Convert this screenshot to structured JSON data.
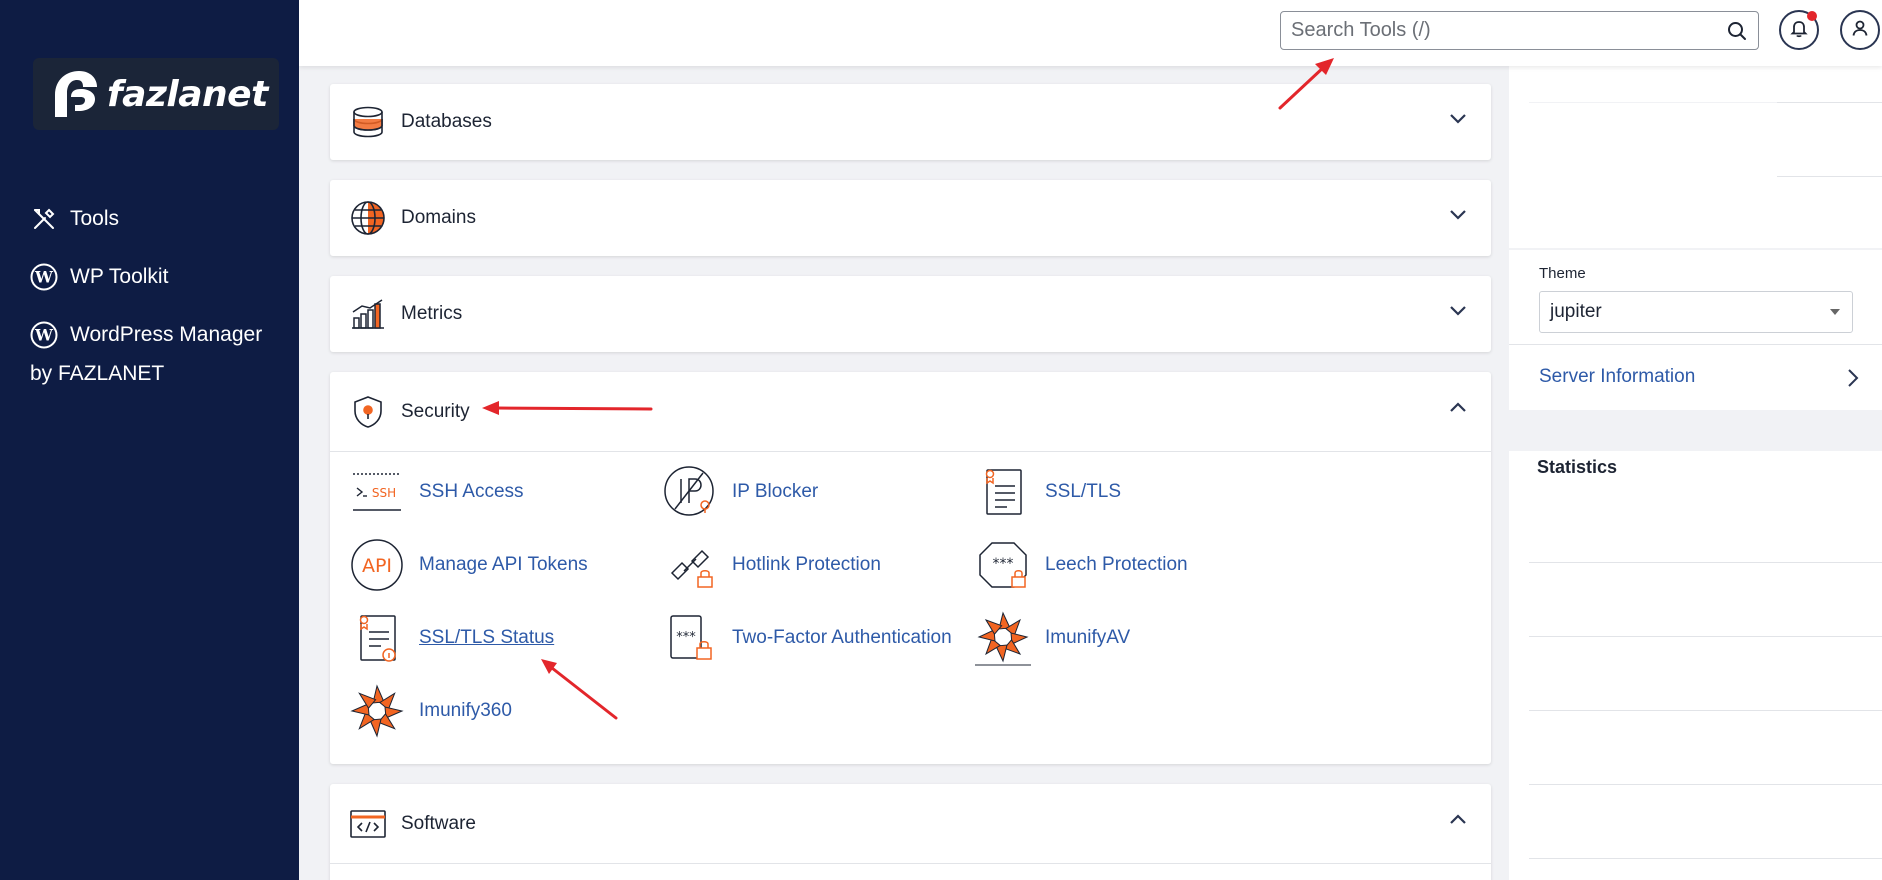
{
  "sidebar": {
    "logo_text": "fazlanet",
    "items": [
      {
        "label": "Tools",
        "icon": "tools-icon"
      },
      {
        "label": "WP Toolkit",
        "icon": "wordpress-icon"
      },
      {
        "label": "WordPress Manager",
        "icon": "wordpress-icon"
      }
    ],
    "item3_sub": "by FAZLANET"
  },
  "topbar": {
    "search_placeholder": "Search Tools (/)",
    "notification_badge_color": "#e3262b"
  },
  "panels": {
    "databases": {
      "title": "Databases"
    },
    "domains": {
      "title": "Domains"
    },
    "metrics": {
      "title": "Metrics"
    },
    "security": {
      "title": "Security",
      "tools": [
        {
          "label": "SSH Access",
          "icon": "ssh-icon"
        },
        {
          "label": "IP Blocker",
          "icon": "ip-blocker-icon"
        },
        {
          "label": "SSL/TLS",
          "icon": "ssl-certificate-icon"
        },
        {
          "label": "Manage API Tokens",
          "icon": "api-icon"
        },
        {
          "label": "Hotlink Protection",
          "icon": "hotlink-icon"
        },
        {
          "label": "Leech Protection",
          "icon": "leech-icon"
        },
        {
          "label": "SSL/TLS Status",
          "icon": "ssl-status-icon"
        },
        {
          "label": "Two-Factor Authentication",
          "icon": "two-factor-icon"
        },
        {
          "label": "ImunifyAV",
          "icon": "imunify-icon"
        },
        {
          "label": "Imunify360",
          "icon": "imunify-icon"
        }
      ]
    },
    "software": {
      "title": "Software"
    }
  },
  "right": {
    "theme_label": "Theme",
    "theme_value": "jupiter",
    "server_info": "Server Information",
    "statistics": "Statistics"
  },
  "colors": {
    "sidebar_bg": "#0e1c44",
    "link": "#2e5aa8",
    "accent_orange": "#f26522",
    "annotation_red": "#e3262b"
  }
}
